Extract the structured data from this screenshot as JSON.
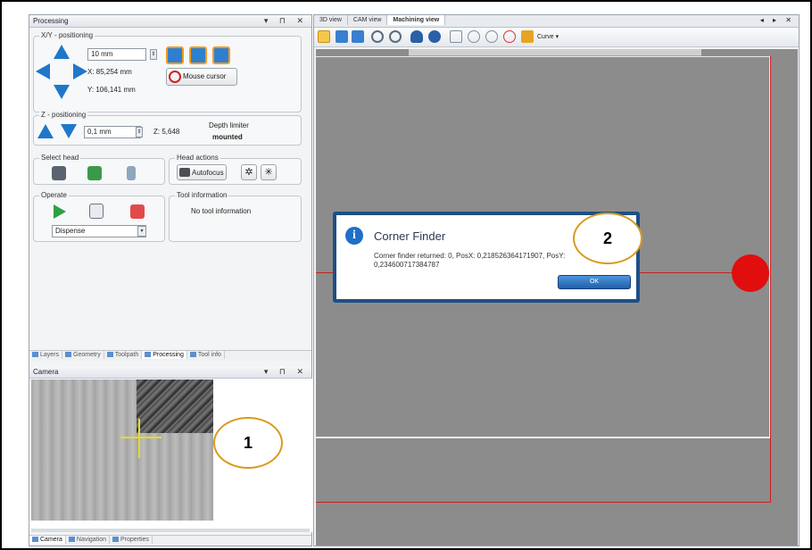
{
  "left_panel": {
    "title": "Processing",
    "title_controls": "▾ ⊓ ✕",
    "xy_group": {
      "label": "X/Y - positioning",
      "step_value": "10 mm",
      "x_readout": "X:  85,254 mm",
      "y_readout": "Y:  106,141 mm",
      "mouse_cursor_label": "Mouse cursor"
    },
    "z_group": {
      "label": "Z - positioning",
      "step_value": "0,1 mm",
      "z_readout": "Z:  5,648",
      "depth_limiter_label": "Depth limiter",
      "depth_limiter_state": "mounted"
    },
    "select_head": {
      "label": "Select head"
    },
    "head_actions": {
      "label": "Head actions",
      "autofocus_label": "Autofocus"
    },
    "operate": {
      "label": "Operate",
      "mode_value": "Dispense"
    },
    "tool_information": {
      "label": "Tool information",
      "text": "No tool information"
    },
    "tabs": [
      "Layers",
      "Geometry",
      "Toolpath",
      "Processing",
      "Tool info"
    ],
    "active_tab": "Processing",
    "camera_title": "Camera",
    "bottom_tabs": [
      "Camera",
      "Navigation",
      "Properties"
    ]
  },
  "right_panel": {
    "tabs": [
      "3D view",
      "CAM view",
      "Machining view"
    ],
    "active_tab": "Machining view",
    "tab_controls": "◂ ▸ ✕",
    "toolbar_curve_label": "Curve ▾"
  },
  "dialog": {
    "title": "Corner Finder",
    "message": "Corner finder returned: 0, PosX: 0,218526364171907, PosY: 0,234600717384787",
    "ok_label": "OK"
  },
  "callouts": [
    "1",
    "2"
  ],
  "colors": {
    "accent_blue": "#1f77c9",
    "red_marker": "#e00e0e",
    "callout_border": "#d89a1c"
  }
}
